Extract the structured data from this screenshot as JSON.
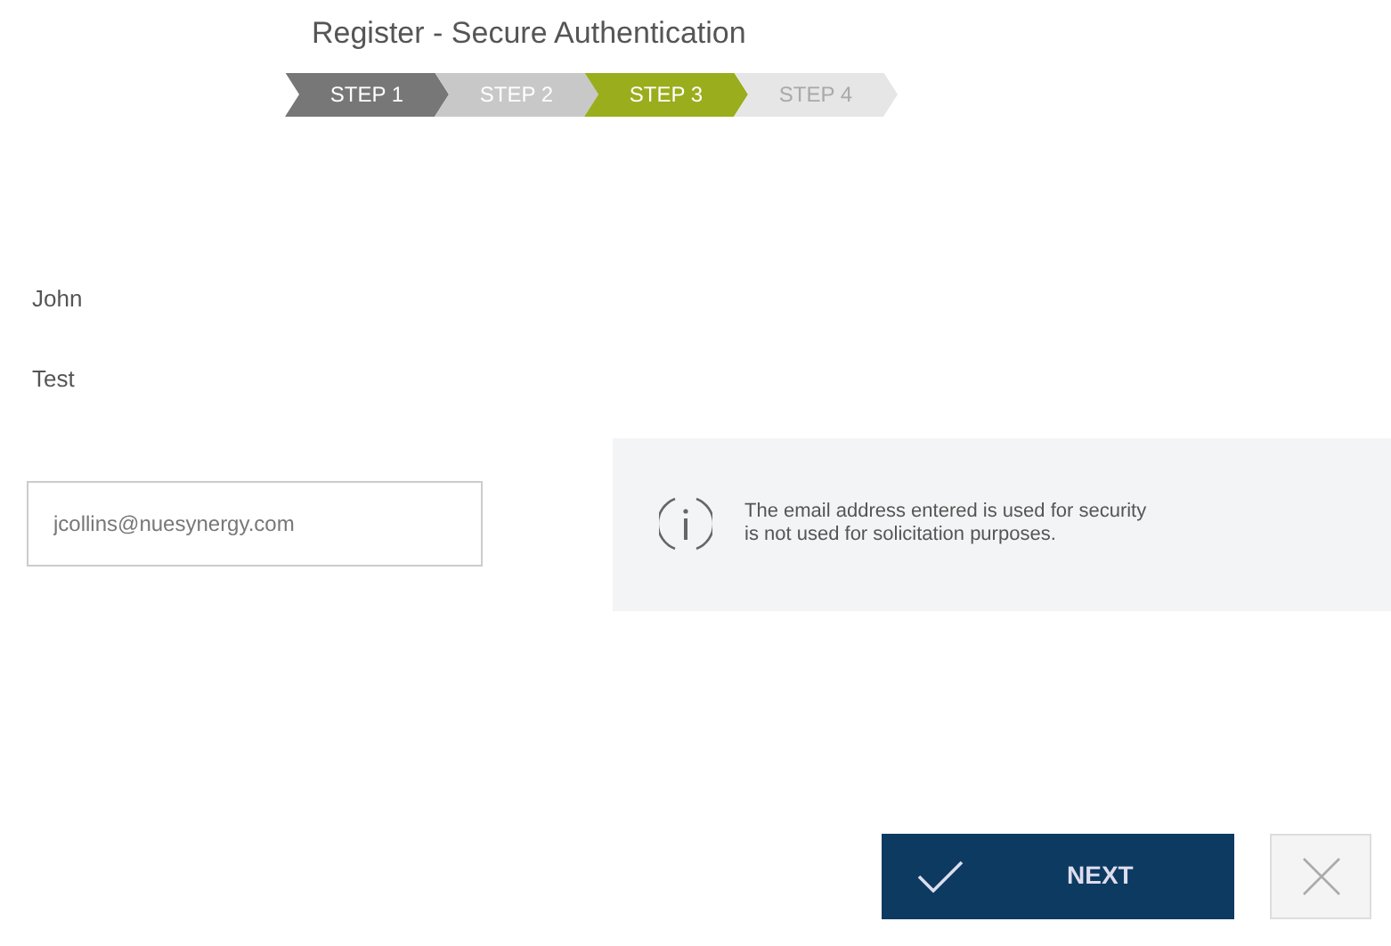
{
  "title": "Register - Secure Authentication",
  "steps": [
    {
      "label": "STEP 1",
      "kind": "done",
      "selected": false
    },
    {
      "label": "STEP 2",
      "kind": "open",
      "selected": false
    },
    {
      "label": "STEP 3",
      "kind": "open",
      "selected": true
    },
    {
      "label": "STEP 4",
      "kind": "locked",
      "selected": false
    }
  ],
  "fields": [
    {
      "kind": "text",
      "value": "John"
    },
    {
      "kind": "text",
      "value": "Test"
    },
    {
      "kind": "input",
      "value": "jcollins@nuesynergy.com"
    }
  ],
  "info": {
    "lines": [
      "The email address entered is used for security",
      "is not used for solicitation purposes."
    ]
  },
  "buttons": [
    {
      "kind": "next",
      "label": "NEXT"
    },
    {
      "kind": "cancel"
    }
  ]
}
